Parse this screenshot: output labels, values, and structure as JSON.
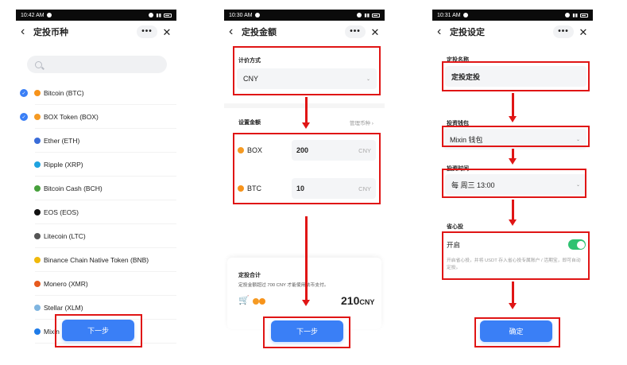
{
  "screens": [
    {
      "status_time": "10:42 AM",
      "title": "定投币种",
      "more": "•••",
      "close": "✕",
      "coins": [
        {
          "label": "Bitcoin (BTC)",
          "checked": true,
          "color": "#f7931a"
        },
        {
          "label": "BOX Token (BOX)",
          "checked": true,
          "color": "#f59a23"
        },
        {
          "label": "Ether (ETH)",
          "checked": false,
          "color": "#3a6cd8"
        },
        {
          "label": "Ripple (XRP)",
          "checked": false,
          "color": "#1fa3e0"
        },
        {
          "label": "Bitcoin Cash (BCH)",
          "checked": false,
          "color": "#47a03c"
        },
        {
          "label": "EOS (EOS)",
          "checked": false,
          "color": "#111111"
        },
        {
          "label": "Litecoin (LTC)",
          "checked": false,
          "color": "#555555"
        },
        {
          "label": "Binance Chain Native Token (BNB)",
          "checked": false,
          "color": "#f0b90b"
        },
        {
          "label": "Monero (XMR)",
          "checked": false,
          "color": "#e65a1e"
        },
        {
          "label": "Stellar (XLM)",
          "checked": false,
          "color": "#7fb5e0"
        },
        {
          "label": "Mixin",
          "checked": false,
          "color": "#1e7be8"
        }
      ],
      "next_button": "下一步"
    },
    {
      "status_time": "10:30 AM",
      "title": "定投金额",
      "more": "•••",
      "close": "✕",
      "pricing_label": "计价方式",
      "pricing_value": "CNY",
      "amount_label": "设置金额",
      "manage_link": "管理币种 ›",
      "amounts": [
        {
          "coin": "BOX",
          "value": "200",
          "unit": "CNY",
          "color": "#f59a23"
        },
        {
          "coin": "BTC",
          "value": "10",
          "unit": "CNY",
          "color": "#f7931a"
        }
      ],
      "summary_title": "定投合计",
      "summary_note": "定投金额超过 700 CNY 才能使用法币支付。",
      "total_value": "210",
      "total_unit": "CNY",
      "next_button": "下一步"
    },
    {
      "status_time": "10:31 AM",
      "title": "定投设定",
      "more": "•••",
      "close": "✕",
      "name_label": "定投名称",
      "name_value": "定投定投",
      "wallet_label": "投资钱包",
      "wallet_value": "Mixin 钱包",
      "time_label": "投资时间",
      "time_value": "每 周三 13:00",
      "saver_label": "省心投",
      "toggle_label": "开启",
      "toggle_on": true,
      "saver_desc": "开启省心投，并将 USDT 存入省心投专属账户 / 活期宝，即可自动定投。",
      "confirm_button": "确定"
    }
  ],
  "colors": {
    "accent": "#3a7ff6",
    "annotation": "#e01515",
    "toggle": "#2fc271"
  }
}
